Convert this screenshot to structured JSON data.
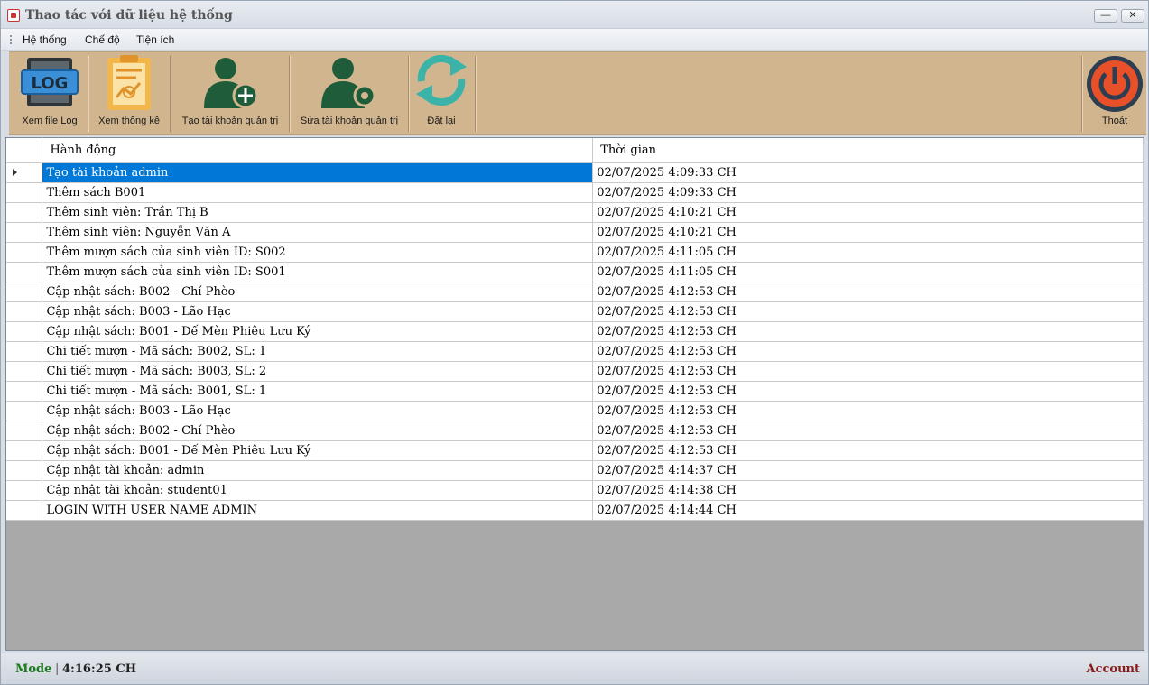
{
  "window": {
    "title": "Thao tác với dữ liệu hệ thống",
    "minimize_glyph": "—",
    "close_glyph": "✕"
  },
  "menu": {
    "items": [
      "Hệ thống",
      "Chế độ",
      "Tiện ích"
    ]
  },
  "toolbar": {
    "buttons": [
      {
        "label": "Xem file Log",
        "icon": "log-file-icon"
      },
      {
        "label": "Xem thống kê",
        "icon": "statistics-clipboard-icon"
      },
      {
        "label": "Tạo tài khoản quản trị",
        "icon": "add-user-icon"
      },
      {
        "label": "Sửa tài khoản quản trị",
        "icon": "user-settings-icon"
      },
      {
        "label": "Đặt lại",
        "icon": "refresh-icon"
      },
      {
        "label": "Thoát",
        "icon": "power-icon"
      }
    ],
    "log_icon_text": "LOG"
  },
  "grid": {
    "columns": [
      "Hành động",
      "Thời gian"
    ],
    "selected_row": 0,
    "rows": [
      {
        "action": "Tạo tài khoản admin",
        "time": "02/07/2025 4:09:33 CH"
      },
      {
        "action": "Thêm sách B001",
        "time": "02/07/2025 4:09:33 CH"
      },
      {
        "action": "Thêm sinh viên: Trần Thị B",
        "time": "02/07/2025 4:10:21 CH"
      },
      {
        "action": "Thêm sinh viên: Nguyễn Văn A",
        "time": "02/07/2025 4:10:21 CH"
      },
      {
        "action": "Thêm mượn sách của sinh viên ID: S002",
        "time": "02/07/2025 4:11:05 CH"
      },
      {
        "action": "Thêm mượn sách của sinh viên ID: S001",
        "time": "02/07/2025 4:11:05 CH"
      },
      {
        "action": "Cập nhật sách: B002 - Chí Phèo",
        "time": "02/07/2025 4:12:53 CH"
      },
      {
        "action": "Cập nhật sách: B003 - Lão Hạc",
        "time": "02/07/2025 4:12:53 CH"
      },
      {
        "action": "Cập nhật sách: B001 - Dế Mèn Phiêu Lưu Ký",
        "time": "02/07/2025 4:12:53 CH"
      },
      {
        "action": "Chi tiết mượn - Mã sách: B002, SL: 1",
        "time": "02/07/2025 4:12:53 CH"
      },
      {
        "action": "Chi tiết mượn - Mã sách: B003, SL: 2",
        "time": "02/07/2025 4:12:53 CH"
      },
      {
        "action": "Chi tiết mượn - Mã sách: B001, SL: 1",
        "time": "02/07/2025 4:12:53 CH"
      },
      {
        "action": "Cập nhật sách: B003 - Lão Hạc",
        "time": "02/07/2025 4:12:53 CH"
      },
      {
        "action": "Cập nhật sách: B002 - Chí Phèo",
        "time": "02/07/2025 4:12:53 CH"
      },
      {
        "action": "Cập nhật sách: B001 - Dế Mèn Phiêu Lưu Ký",
        "time": "02/07/2025 4:12:53 CH"
      },
      {
        "action": "Cập nhật tài khoản: admin",
        "time": "02/07/2025 4:14:37 CH"
      },
      {
        "action": "Cập nhật tài khoản: student01",
        "time": "02/07/2025 4:14:38 CH"
      },
      {
        "action": "LOGIN WITH USER NAME ADMIN",
        "time": "02/07/2025 4:14:44 CH"
      }
    ]
  },
  "status": {
    "mode": "Mode",
    "separator": "|",
    "time": "4:16:25 CH",
    "account": "Account"
  },
  "colors": {
    "toolbar_bg": "#d1b58f",
    "selection": "#0078d7",
    "mode_text": "#1e7a1e",
    "account_text": "#8b1a1a",
    "icon_green": "#1f5c3a",
    "refresh_teal": "#3bb3a8",
    "power_orange": "#e8502a"
  }
}
